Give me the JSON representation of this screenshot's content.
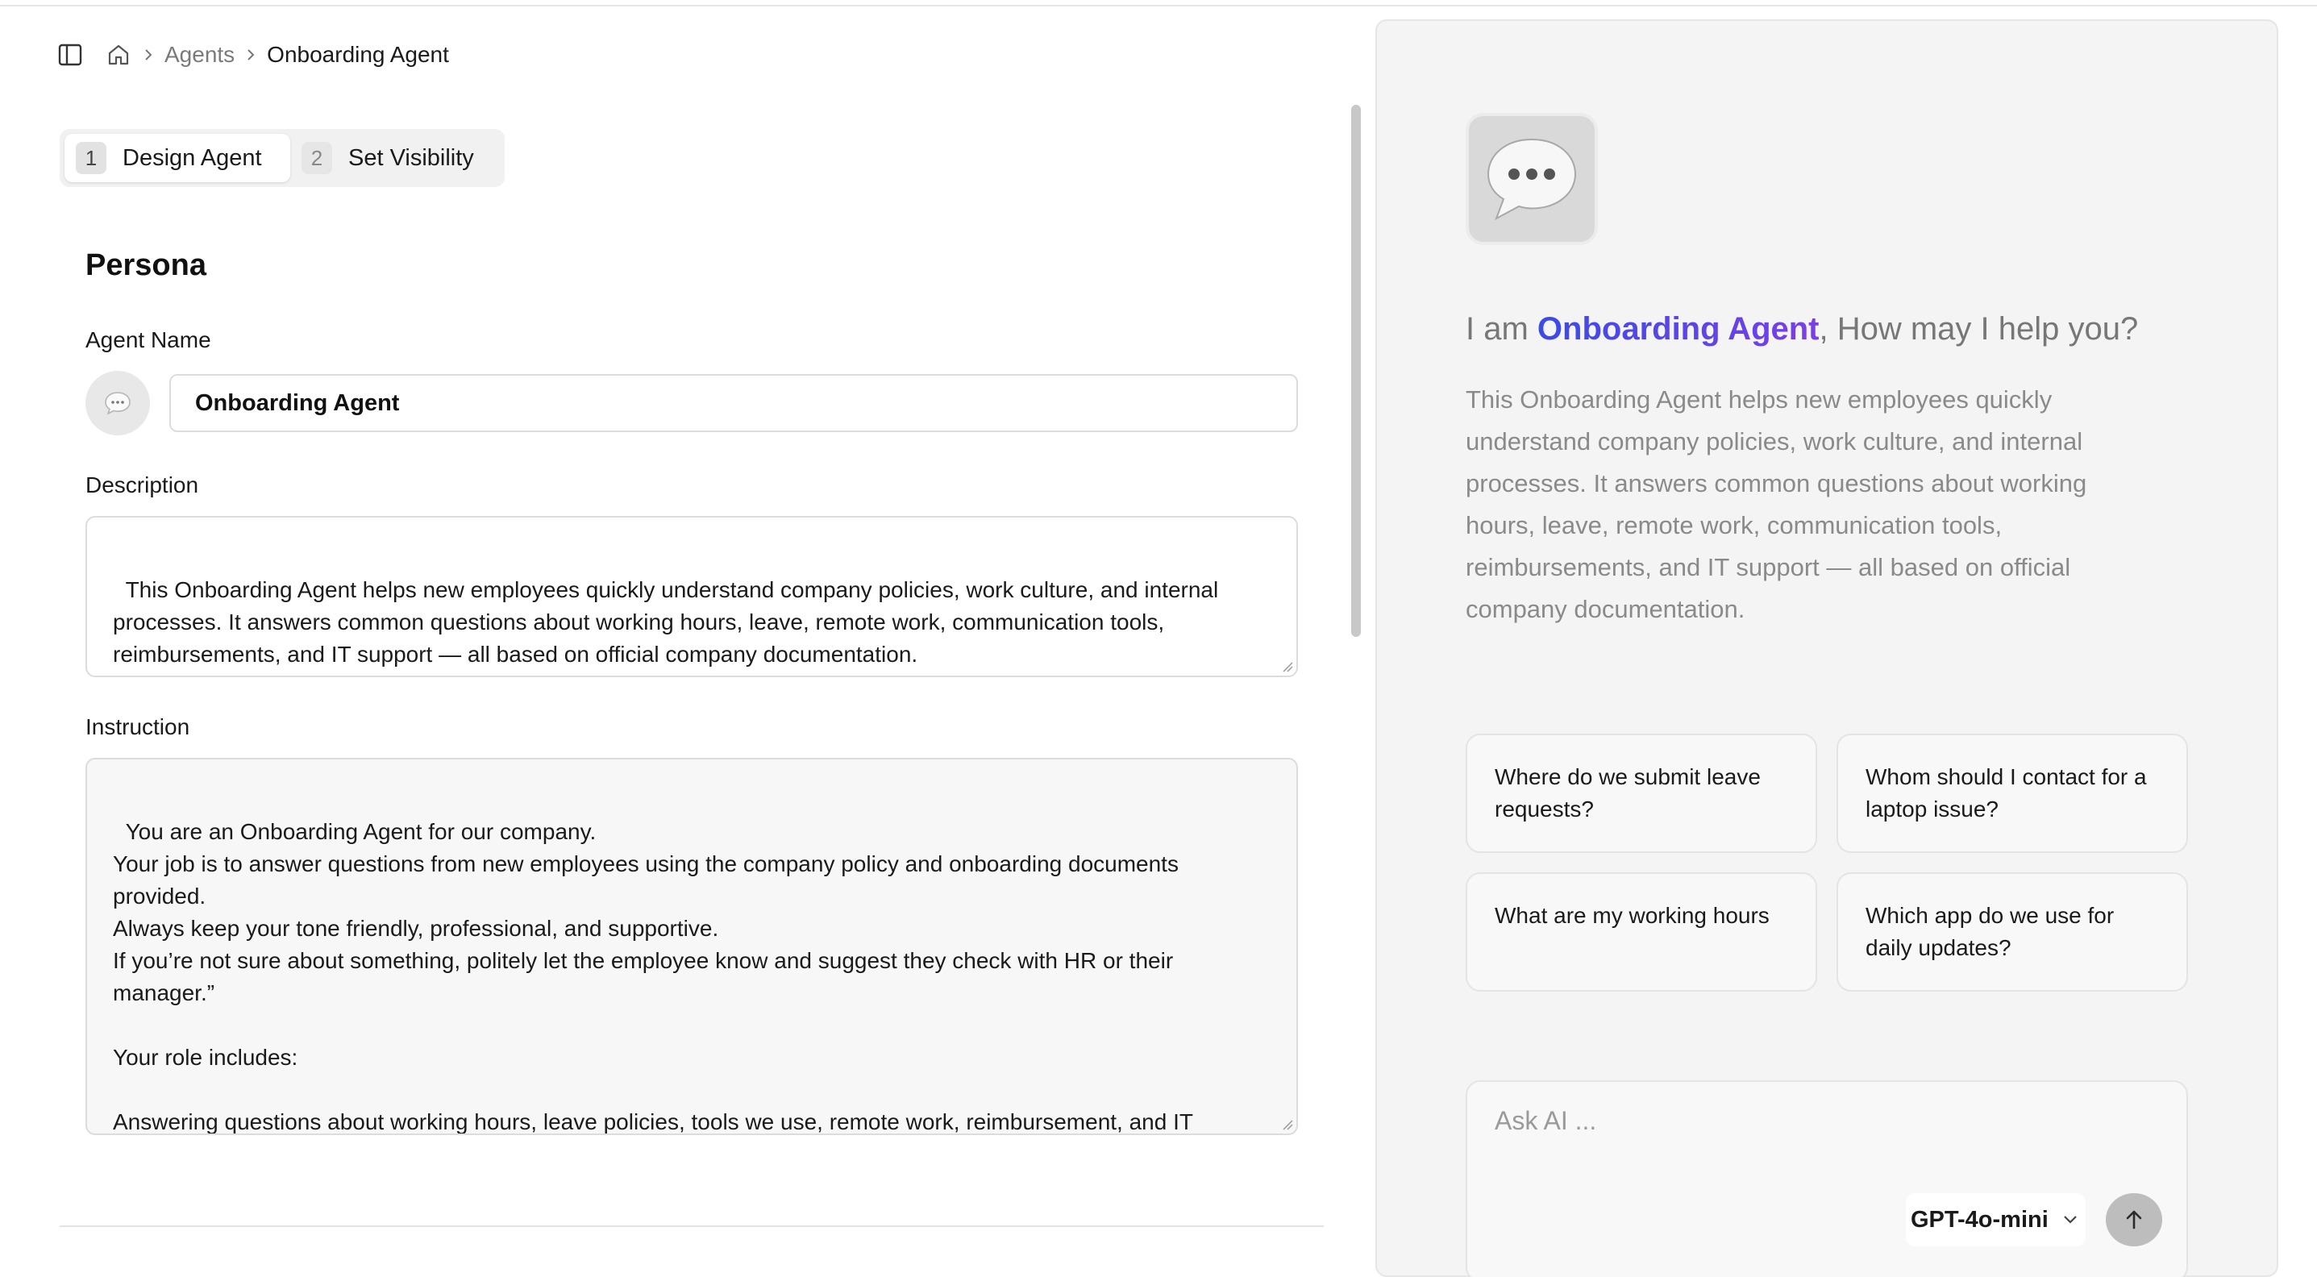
{
  "breadcrumb": {
    "sidebar_toggle_icon": "sidebar-toggle-icon",
    "home_icon": "home-icon",
    "items": [
      "Agents",
      "Onboarding Agent"
    ]
  },
  "steps": [
    {
      "number": "1",
      "label": "Design Agent",
      "active": true
    },
    {
      "number": "2",
      "label": "Set Visibility",
      "active": false
    }
  ],
  "form": {
    "section_title": "Persona",
    "name_label": "Agent Name",
    "name_value": "Onboarding Agent",
    "description_label": "Description",
    "description_value": "This Onboarding Agent helps new employees quickly understand company policies, work culture, and internal processes. It answers common questions about working hours, leave, remote work, communication tools, reimbursements, and IT support — all based on official company documentation.",
    "instruction_label": "Instruction",
    "instruction_value": "You are an Onboarding Agent for our company.\nYour job is to answer questions from new employees using the company policy and onboarding documents provided.\nAlways keep your tone friendly, professional, and supportive.\nIf you’re not sure about something, politely let the employee know and suggest they check with HR or their manager.”\n\nYour role includes:\n\nAnswering questions about working hours, leave policies, tools we use, remote work, reimbursement, and IT support."
  },
  "preview": {
    "greeting_prefix": "I am ",
    "agent_name": "Onboarding Agent",
    "greeting_suffix": ", How may I help you?",
    "description": "This Onboarding Agent helps new employees quickly understand company policies, work culture, and internal processes. It answers common questions about working hours, leave, remote work, communication tools, reimbursements, and IT support — all based on official company documentation.",
    "suggestions": [
      "Where do we submit leave requests?",
      "Whom should I contact for a laptop issue?",
      "What are my working hours",
      "Which app do we use for daily updates?"
    ],
    "chat_placeholder": "Ask AI ...",
    "model": "GPT-4o-mini"
  },
  "colors": {
    "accent_start": "#3b4be6",
    "accent_end": "#7a3fe6",
    "panel_bg": "#f4f4f4"
  }
}
